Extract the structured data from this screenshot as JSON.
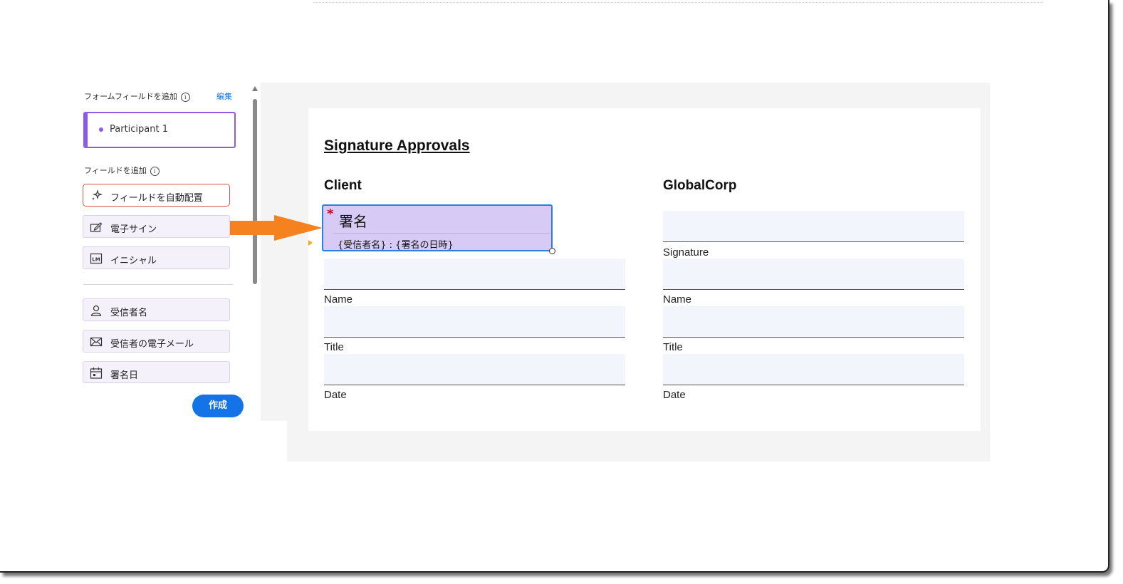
{
  "panel": {
    "form_fields_title": "フォームフィールドを追加",
    "edit_link": "編集",
    "participant": "Participant 1",
    "add_fields_title": "フィールドを追加",
    "buttons": [
      {
        "label": "フィールドを自動配置",
        "icon": "sparkle-icon"
      },
      {
        "label": "電子サイン",
        "icon": "signature-pen-icon"
      },
      {
        "label": "イニシャル",
        "icon": "initials-icon"
      },
      {
        "label": "受信者名",
        "icon": "person-icon"
      },
      {
        "label": "受信者の電子メール",
        "icon": "envelope-icon"
      },
      {
        "label": "署名日",
        "icon": "calendar-icon"
      }
    ],
    "create_button": "作成"
  },
  "document": {
    "title": "Signature Approvals",
    "client_heading": "Client",
    "globalcorp_heading": "GlobalCorp",
    "labels": {
      "signature": "Signature",
      "name": "Name",
      "title": "Title",
      "date": "Date"
    },
    "signature_field": {
      "required_mark": "*",
      "title": "署名",
      "subtitle": "{受信者名} : {署名の日時}"
    }
  },
  "colors": {
    "participant_accent": "#8e5be6",
    "primary_button": "#1473e6",
    "signature_field_fill": "#d7cbf6",
    "selection_border": "#2e7de0",
    "arrow": "#f5821f"
  }
}
